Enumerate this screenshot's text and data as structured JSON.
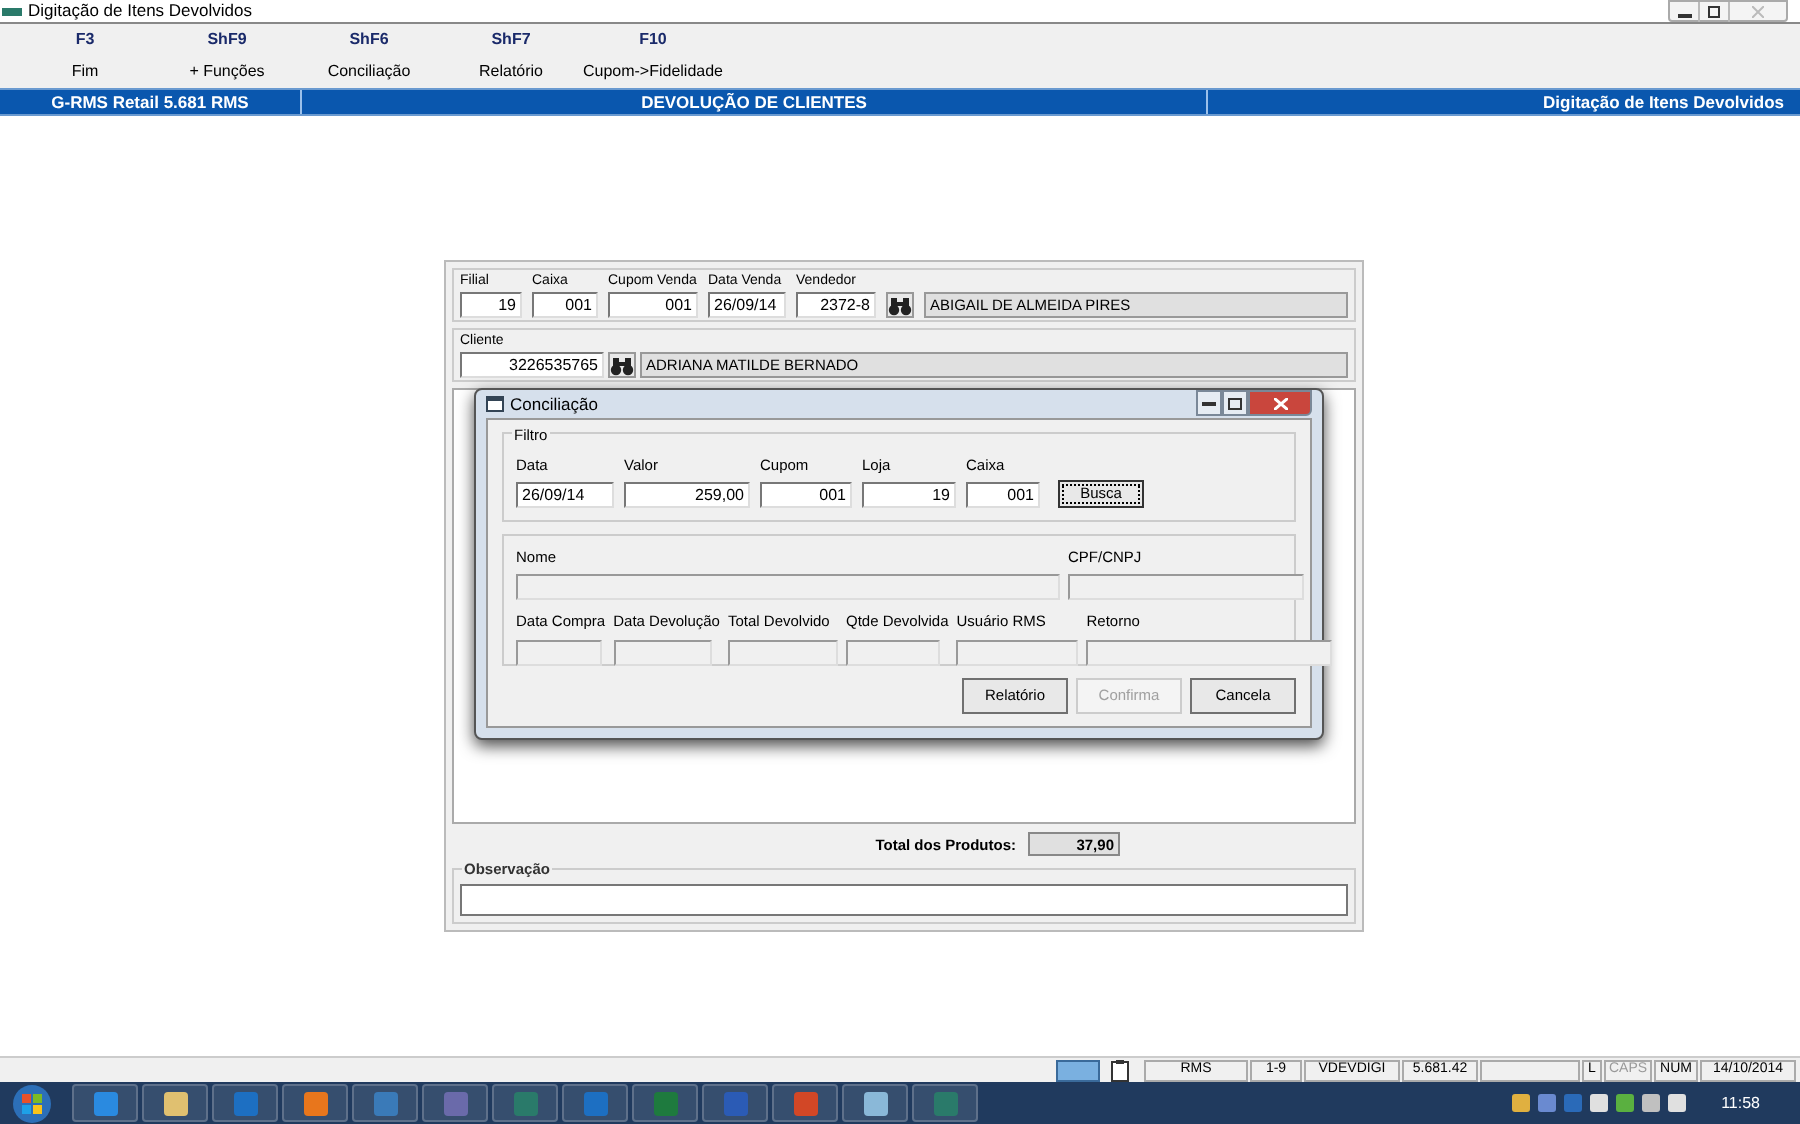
{
  "window": {
    "title": "Digitação de Itens Devolvidos"
  },
  "function_keys": [
    {
      "key": "F3",
      "label": "Fim"
    },
    {
      "key": "ShF9",
      "label": "+ Funções"
    },
    {
      "key": "ShF6",
      "label": "Conciliação"
    },
    {
      "key": "ShF7",
      "label": "Relatório"
    },
    {
      "key": "F10",
      "label": "Cupom->Fidelidade"
    }
  ],
  "header_bar": {
    "left": "G-RMS Retail 5.681 RMS",
    "center": "DEVOLUÇÃO DE CLIENTES",
    "right": "Digitação de Itens Devolvidos"
  },
  "sale": {
    "fields": [
      {
        "label": "Filial",
        "value": "19",
        "kind": "number"
      },
      {
        "label": "Caixa",
        "value": "001",
        "kind": "number"
      },
      {
        "label": "Cupom Venda",
        "value": "001",
        "kind": "number"
      },
      {
        "label": "Data Venda",
        "value": "26/09/14",
        "kind": "date"
      },
      {
        "label": "Vendedor",
        "value": "2372-8",
        "kind": "number"
      }
    ],
    "seller_name": "ABIGAIL DE ALMEIDA PIRES"
  },
  "client": {
    "label": "Cliente",
    "value": "3226535765",
    "name": "ADRIANA MATILDE BERNADO"
  },
  "totals": {
    "label": "Total dos Produtos:",
    "value": "37,90"
  },
  "observation": {
    "label": "Observação"
  },
  "dialog": {
    "title": "Conciliação",
    "filter": {
      "label": "Filtro",
      "fields": [
        {
          "label": "Data",
          "value": "26/09/14",
          "kind": "date"
        },
        {
          "label": "Valor",
          "value": "259,00",
          "kind": "number"
        },
        {
          "label": "Cupom",
          "value": "001",
          "kind": "number"
        },
        {
          "label": "Loja",
          "value": "19",
          "kind": "number"
        },
        {
          "label": "Caixa",
          "value": "001",
          "kind": "number"
        }
      ],
      "search_button": "Busca"
    },
    "result_rows": [
      [
        {
          "label": "Nome"
        },
        {
          "label": "CPF/CNPJ"
        }
      ],
      [
        {
          "label": "Data Compra"
        },
        {
          "label": "Data Devolução"
        },
        {
          "label": "Total Devolvido"
        },
        {
          "label": "Qtde Devolvida"
        },
        {
          "label": "Usuário RMS"
        },
        {
          "label": "Retorno"
        }
      ]
    ],
    "buttons": [
      {
        "label": "Relatório",
        "disabled": false
      },
      {
        "label": "Confirma",
        "disabled": true
      },
      {
        "label": "Cancela",
        "disabled": false
      }
    ]
  },
  "status_bar": [
    {
      "text": "RMS",
      "active": true
    },
    {
      "text": "1-9",
      "active": true
    },
    {
      "text": "VDEVDIGI",
      "active": true
    },
    {
      "text": "5.681.42",
      "active": true
    },
    {
      "text": "L",
      "active": true
    },
    {
      "text": "CAPS",
      "active": false
    },
    {
      "text": "NUM",
      "active": true
    },
    {
      "text": "14/10/2014",
      "active": true
    }
  ],
  "taskbar": {
    "clock": "11:58"
  }
}
